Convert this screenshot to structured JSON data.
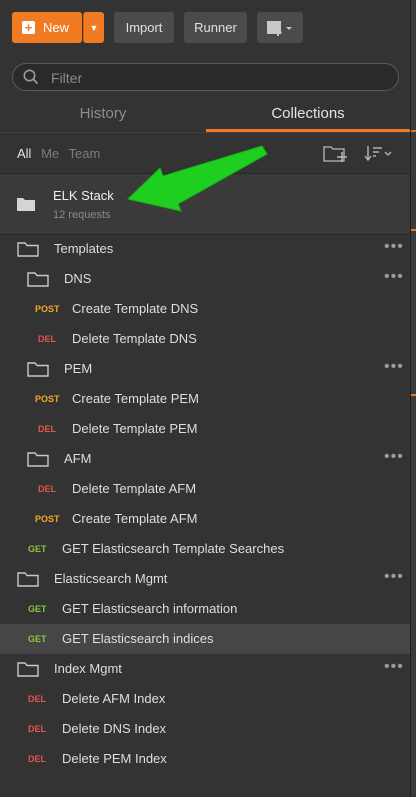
{
  "toolbar": {
    "new_label": "New",
    "import_label": "Import",
    "runner_label": "Runner"
  },
  "search": {
    "placeholder": "Filter"
  },
  "tabs": [
    {
      "label": "History",
      "active": false
    },
    {
      "label": "Collections",
      "active": true
    }
  ],
  "filters": {
    "all": "All",
    "me": "Me",
    "team": "Team"
  },
  "collection": {
    "name": "ELK Stack",
    "count": "12 requests"
  },
  "tree": [
    {
      "type": "folder",
      "label": "Templates"
    },
    {
      "type": "folder",
      "label": "DNS"
    },
    {
      "type": "request",
      "method": "POST",
      "label": "Create Template DNS"
    },
    {
      "type": "request",
      "method": "DEL",
      "label": "Delete Template DNS"
    },
    {
      "type": "folder",
      "label": "PEM"
    },
    {
      "type": "request",
      "method": "POST",
      "label": "Create Template PEM"
    },
    {
      "type": "request",
      "method": "DEL",
      "label": "Delete Template PEM"
    },
    {
      "type": "folder",
      "label": "AFM"
    },
    {
      "type": "request",
      "method": "DEL",
      "label": "Delete Template AFM"
    },
    {
      "type": "request",
      "method": "POST",
      "label": "Create Template AFM"
    },
    {
      "type": "request",
      "method": "GET",
      "label": "GET Elasticsearch Template Searches"
    },
    {
      "type": "folder",
      "label": "Elasticsearch Mgmt"
    },
    {
      "type": "request",
      "method": "GET",
      "label": "GET Elasticsearch information"
    },
    {
      "type": "request",
      "method": "GET",
      "label": "GET Elasticsearch indices",
      "selected": true
    },
    {
      "type": "folder",
      "label": "Index Mgmt"
    },
    {
      "type": "request",
      "method": "DEL",
      "label": "Delete AFM Index"
    },
    {
      "type": "request",
      "method": "DEL",
      "label": "Delete DNS Index"
    },
    {
      "type": "request",
      "method": "DEL",
      "label": "Delete PEM Index"
    }
  ],
  "more_glyph": "•••",
  "colors": {
    "accent": "#f07b22",
    "post": "#f5a623",
    "del": "#e2554f",
    "get": "#88c83d",
    "annotation_arrow": "#22dd22"
  }
}
